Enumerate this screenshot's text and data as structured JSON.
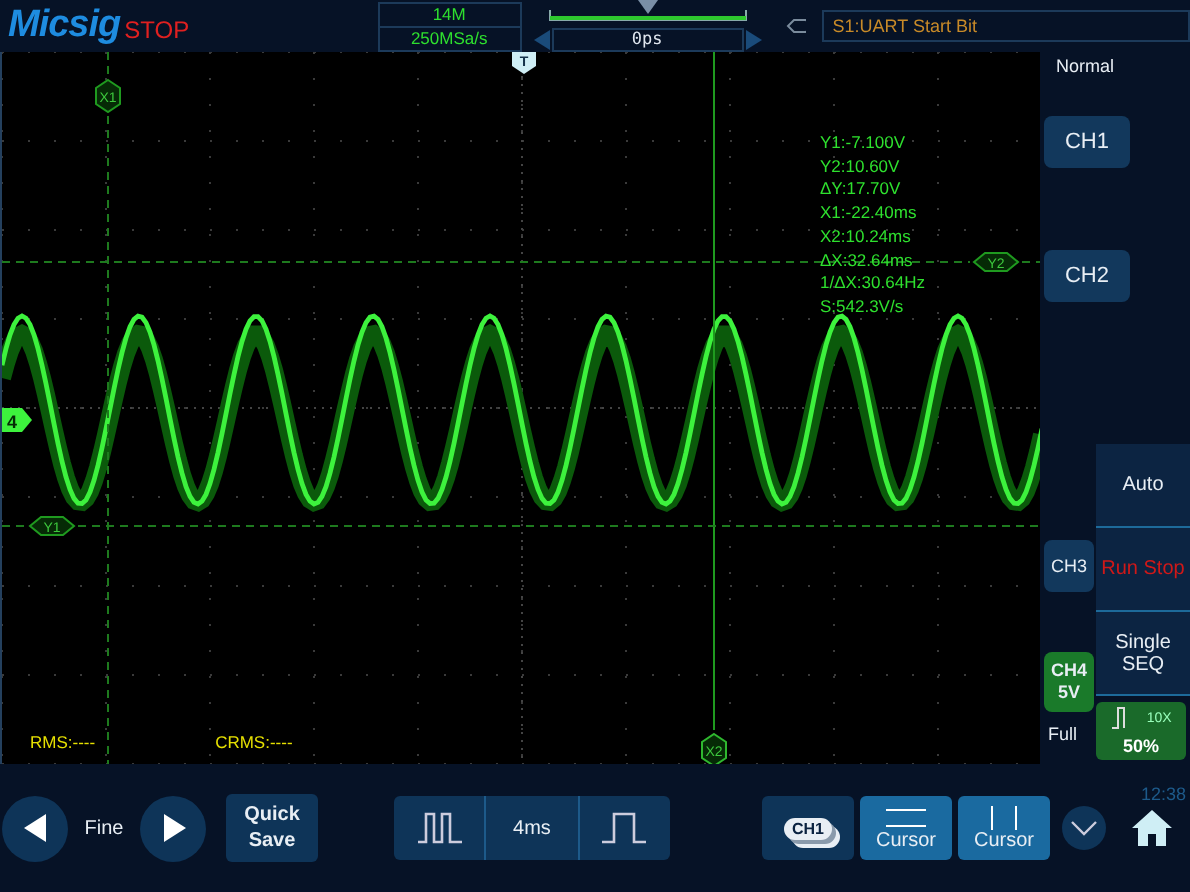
{
  "header": {
    "logo": "Micsig",
    "run_state": "STOP",
    "memory_depth": "14M",
    "sample_rate": "250MSa/s",
    "time_offset": "0ps",
    "trigger_label": "S1:UART Start Bit"
  },
  "plot": {
    "markers": [
      {
        "label": "X1",
        "kind": "vcursor",
        "solid": false
      },
      {
        "label": "X2",
        "kind": "vcursor",
        "solid": true
      },
      {
        "label": "Y1",
        "kind": "hcursor",
        "solid": false
      },
      {
        "label": "Y2",
        "kind": "hcursor",
        "solid": false
      }
    ],
    "trigger_marker": "T",
    "channel_marker": "4",
    "readouts": [
      "Y1:-7.100V",
      "Y2:10.60V",
      "ΔY:17.70V",
      "X1:-22.40ms",
      "X2:10.24ms",
      "ΔX:32.64ms",
      "1/ΔX:30.64Hz",
      "S:542.3V/s"
    ],
    "measurements": [
      "RMS:----",
      "CRMS:----"
    ]
  },
  "side": {
    "mode": "Normal",
    "channels": [
      {
        "label": "CH1",
        "active": false
      },
      {
        "label": "CH2",
        "active": false
      },
      {
        "label": "CH3",
        "active": false
      },
      {
        "label": "CH4",
        "active": true,
        "scale": "5V"
      }
    ],
    "coupling": "Full",
    "probe": "10X",
    "level": "50%",
    "actions": [
      {
        "label": "Auto",
        "kind": "plain"
      },
      {
        "label": "Run Stop",
        "kind": "warn"
      },
      {
        "label": "Single SEQ",
        "kind": "plain"
      }
    ],
    "clock": "12:38"
  },
  "footer": {
    "fine": "Fine",
    "quick_save": "Quick Save",
    "timebase": "4ms",
    "source": {
      "label": "CH1",
      "selected": false
    },
    "cursors": [
      {
        "label": "Cursor",
        "kind": "horizontal",
        "selected": true
      },
      {
        "label": "Cursor",
        "kind": "vertical",
        "selected": true
      }
    ]
  }
}
